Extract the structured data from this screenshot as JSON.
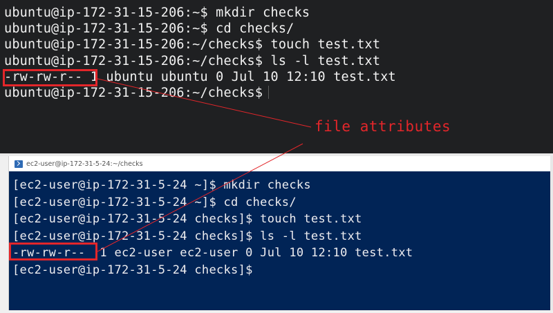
{
  "top_terminal": {
    "lines": [
      "ubuntu@ip-172-31-15-206:~$ mkdir checks",
      "ubuntu@ip-172-31-15-206:~$ cd checks/",
      "ubuntu@ip-172-31-15-206:~/checks$ touch test.txt",
      "ubuntu@ip-172-31-15-206:~/checks$ ls -l test.txt",
      "-rw-rw-r-- 1 ubuntu ubuntu 0 Jul 10 12:10 test.txt",
      "ubuntu@ip-172-31-15-206:~/checks$"
    ]
  },
  "bottom_window": {
    "title": "ec2-user@ip-172-31-5-24:~/checks",
    "icon": "powershell-icon",
    "lines": [
      "[ec2-user@ip-172-31-5-24 ~]$ mkdir checks",
      "[ec2-user@ip-172-31-5-24 ~]$ cd checks/",
      "[ec2-user@ip-172-31-5-24 checks]$ touch test.txt",
      "[ec2-user@ip-172-31-5-24 checks]$ ls -l test.txt",
      "-rw-rw-r--  1 ec2-user ec2-user 0 Jul 10 12:10 test.txt",
      "[ec2-user@ip-172-31-5-24 checks]$"
    ]
  },
  "annotation": {
    "label": "file attributes",
    "color": "#e3262a"
  },
  "colors": {
    "top_bg": "#1f2022",
    "bottom_bg": "#012456",
    "text": "#f2f2f2"
  }
}
